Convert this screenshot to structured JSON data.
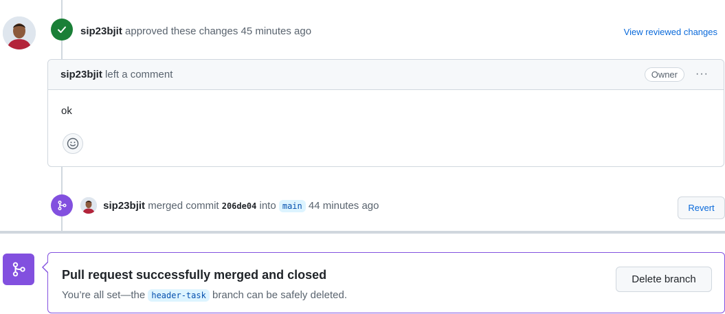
{
  "review": {
    "author": "sip23bjit",
    "action_text": "approved these changes 45 minutes ago",
    "view_link": "View reviewed changes"
  },
  "comment": {
    "author": "sip23bjit",
    "action_text": "left a comment",
    "role_badge": "Owner",
    "menu": "···",
    "body": "ok"
  },
  "merge_event": {
    "author": "sip23bjit",
    "text_merged": "merged commit",
    "commit_sha": "206de04",
    "text_into": "into",
    "branch": "main",
    "time": "44 minutes ago",
    "revert_label": "Revert"
  },
  "merge_status": {
    "title": "Pull request successfully merged and closed",
    "desc_prefix": "You’re all set—the",
    "branch": "header-task",
    "desc_suffix": "branch can be safely deleted.",
    "delete_label": "Delete branch"
  },
  "colors": {
    "approved": "#1a7f37",
    "merged": "#8250df",
    "link": "#0969da"
  }
}
